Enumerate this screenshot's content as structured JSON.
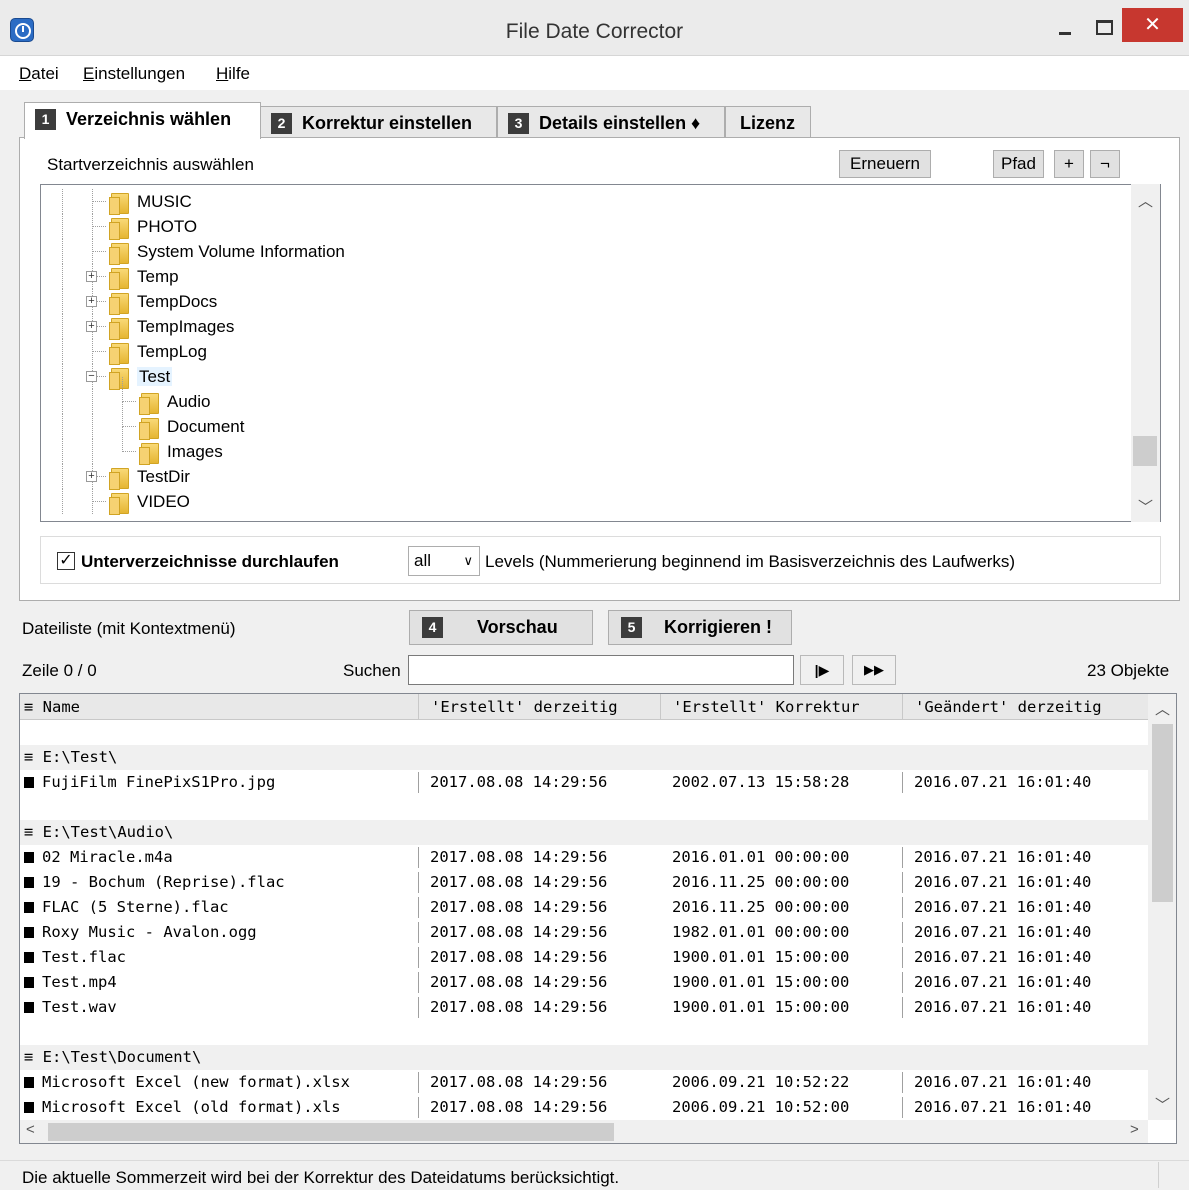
{
  "window": {
    "title": "File Date Corrector",
    "close_glyph": "✕"
  },
  "menu": [
    "Datei",
    "Einstellungen",
    "Hilfe"
  ],
  "tabs": [
    {
      "num": "1",
      "label": "Verzeichnis wählen",
      "active": true
    },
    {
      "num": "2",
      "label": "Korrektur einstellen",
      "active": false
    },
    {
      "num": "3",
      "label": "Details einstellen ♦",
      "active": false
    },
    {
      "num": "",
      "label": "Lizenz",
      "active": false
    }
  ],
  "dir_panel": {
    "label": "Startverzeichnis auswählen",
    "refresh_button": "Erneuern",
    "path_button": "Pfad",
    "plus_button": "+",
    "neg_button": "¬"
  },
  "tree": [
    {
      "label": "MUSIC",
      "level": 1,
      "expander": ""
    },
    {
      "label": "PHOTO",
      "level": 1,
      "expander": ""
    },
    {
      "label": "System Volume Information",
      "level": 1,
      "expander": ""
    },
    {
      "label": "Temp",
      "level": 1,
      "expander": "+"
    },
    {
      "label": "TempDocs",
      "level": 1,
      "expander": "+"
    },
    {
      "label": "TempImages",
      "level": 1,
      "expander": "+"
    },
    {
      "label": "TempLog",
      "level": 1,
      "expander": ""
    },
    {
      "label": "Test",
      "level": 1,
      "expander": "−",
      "selected": true
    },
    {
      "label": "Audio",
      "level": 2,
      "expander": ""
    },
    {
      "label": "Document",
      "level": 2,
      "expander": ""
    },
    {
      "label": "Images",
      "level": 2,
      "expander": ""
    },
    {
      "label": "TestDir",
      "level": 1,
      "expander": "+"
    },
    {
      "label": "VIDEO",
      "level": 1,
      "expander": ""
    }
  ],
  "options": {
    "subdirs_checked": true,
    "check_glyph": "✓",
    "subdirs_label": "Unterverzeichnisse durchlaufen",
    "levels_value": "all",
    "levels_label": "Levels  (Nummerierung beginnend im Basisverzeichnis des Laufwerks)"
  },
  "filelist": {
    "label": "Dateiliste (mit Kontextmenü)",
    "preview_num": "4",
    "preview_button": "Vorschau",
    "correct_num": "5",
    "correct_button": "Korrigieren !",
    "row_status": "Zeile 0 / 0",
    "search_label": "Suchen",
    "search_value": "",
    "next_glyph": "|▶",
    "fast_glyph": "▶▶",
    "count": "23 Objekte"
  },
  "grid": {
    "columns": [
      "≡ Name",
      "'Erstellt' derzeitig",
      "'Erstellt' Korrektur",
      "'Geändert' derzeitig"
    ],
    "rows": [
      {
        "type": "blank"
      },
      {
        "type": "group",
        "name": "≡ E:\\Test\\"
      },
      {
        "type": "file",
        "name": "FujiFilm FinePixS1Pro.jpg",
        "created": "2017.08.08 14:29:56",
        "corrected": "2002.07.13 15:58:28",
        "modified": "2016.07.21 16:01:40"
      },
      {
        "type": "blank"
      },
      {
        "type": "group",
        "name": "≡ E:\\Test\\Audio\\"
      },
      {
        "type": "file",
        "name": "02 Miracle.m4a",
        "created": "2017.08.08 14:29:56",
        "corrected": "2016.01.01 00:00:00",
        "modified": "2016.07.21 16:01:40"
      },
      {
        "type": "file",
        "name": "19 - Bochum (Reprise).flac",
        "created": "2017.08.08 14:29:56",
        "corrected": "2016.11.25 00:00:00",
        "modified": "2016.07.21 16:01:40"
      },
      {
        "type": "file",
        "name": "FLAC (5 Sterne).flac",
        "created": "2017.08.08 14:29:56",
        "corrected": "2016.11.25 00:00:00",
        "modified": "2016.07.21 16:01:40"
      },
      {
        "type": "file",
        "name": "Roxy Music - Avalon.ogg",
        "created": "2017.08.08 14:29:56",
        "corrected": "1982.01.01 00:00:00",
        "modified": "2016.07.21 16:01:40"
      },
      {
        "type": "file",
        "name": "Test.flac",
        "created": "2017.08.08 14:29:56",
        "corrected": "1900.01.01 15:00:00",
        "modified": "2016.07.21 16:01:40"
      },
      {
        "type": "file",
        "name": "Test.mp4",
        "created": "2017.08.08 14:29:56",
        "corrected": "1900.01.01 15:00:00",
        "modified": "2016.07.21 16:01:40"
      },
      {
        "type": "file",
        "name": "Test.wav",
        "created": "2017.08.08 14:29:56",
        "corrected": "1900.01.01 15:00:00",
        "modified": "2016.07.21 16:01:40"
      },
      {
        "type": "blank"
      },
      {
        "type": "group",
        "name": "≡ E:\\Test\\Document\\"
      },
      {
        "type": "file",
        "name": "Microsoft Excel (new format).xlsx",
        "created": "2017.08.08 14:29:56",
        "corrected": "2006.09.21 10:52:22",
        "modified": "2016.07.21 16:01:40"
      },
      {
        "type": "file",
        "name": "Microsoft Excel (old format).xls",
        "created": "2017.08.08 14:29:56",
        "corrected": "2006.09.21 10:52:00",
        "modified": "2016.07.21 16:01:40"
      }
    ]
  },
  "status": "Die aktuelle Sommerzeit wird bei der Korrektur des Dateidatums berücksichtigt."
}
